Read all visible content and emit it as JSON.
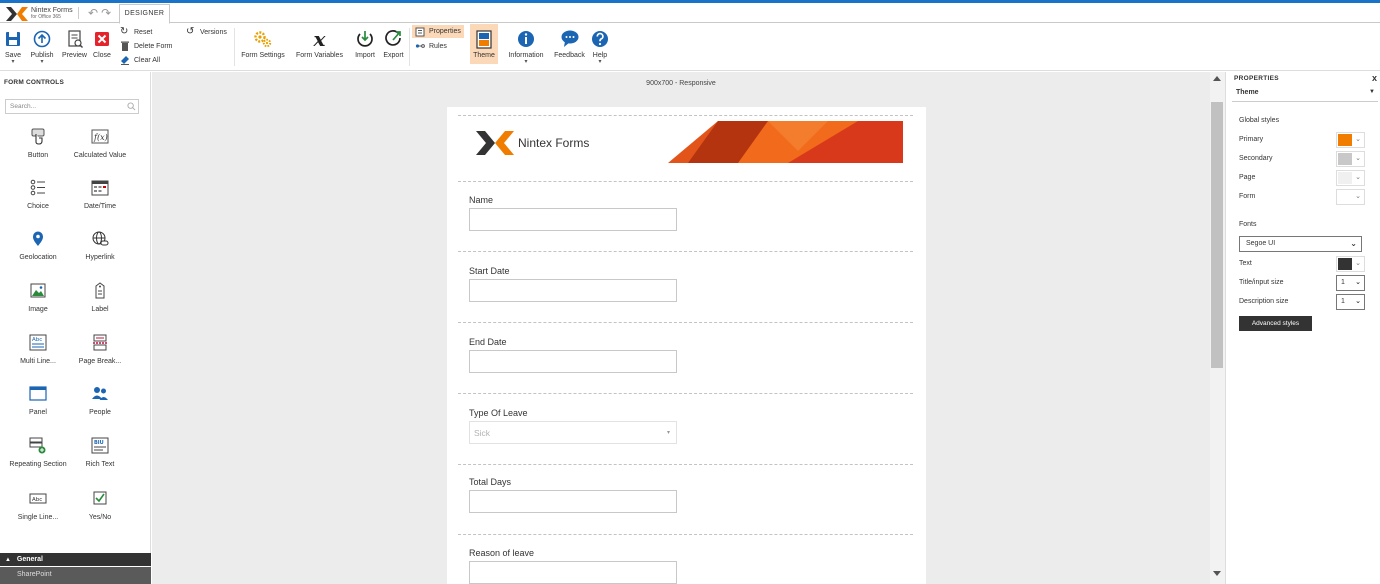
{
  "app": {
    "brand_name": "Nintex Forms",
    "brand_sub": "for Office 365",
    "tab_designer": "DESIGNER",
    "accent_color": "#1a73c6",
    "brand_orange": "#f07d00"
  },
  "ribbon": {
    "save": "Save",
    "publish": "Publish",
    "preview": "Preview",
    "close": "Close",
    "reset": "Reset",
    "delete_form": "Delete Form",
    "clear_all": "Clear All",
    "versions": "Versions",
    "form_settings": "Form Settings",
    "form_variables": "Form Variables",
    "import": "Import",
    "export": "Export",
    "properties": "Properties",
    "rules": "Rules",
    "theme": "Theme",
    "information": "Information",
    "feedback": "Feedback",
    "help": "Help"
  },
  "left_panel": {
    "title": "FORM CONTROLS",
    "search_placeholder": "Search...",
    "controls": [
      {
        "label": "Button"
      },
      {
        "label": "Calculated Value"
      },
      {
        "label": "Choice"
      },
      {
        "label": "Date/Time"
      },
      {
        "label": "Geolocation"
      },
      {
        "label": "Hyperlink"
      },
      {
        "label": "Image"
      },
      {
        "label": "Label"
      },
      {
        "label": "Multi Line..."
      },
      {
        "label": "Page Break..."
      },
      {
        "label": "Panel"
      },
      {
        "label": "People"
      },
      {
        "label": "Repeating Section"
      },
      {
        "label": "Rich Text"
      },
      {
        "label": "Single Line..."
      },
      {
        "label": "Yes/No"
      }
    ],
    "categories": {
      "general": "General",
      "sharepoint": "SharePoint"
    }
  },
  "canvas": {
    "size_label": "900x700 - Responsive",
    "banner_text": "Nintex Forms",
    "fields": [
      {
        "label": "Name",
        "value": ""
      },
      {
        "label": "Start Date",
        "value": ""
      },
      {
        "label": "End Date",
        "value": ""
      },
      {
        "label": "Type Of Leave",
        "value": "Sick"
      },
      {
        "label": "Total Days",
        "value": ""
      },
      {
        "label": "Reason of leave",
        "value": ""
      }
    ]
  },
  "properties": {
    "header": "PROPERTIES",
    "close": "x",
    "selected": "Theme",
    "global_styles": "Global styles",
    "primary": "Primary",
    "secondary": "Secondary",
    "page": "Page",
    "form": "Form",
    "fonts": "Fonts",
    "font_value": "Segoe UI",
    "text": "Text",
    "title_input_size": "Title/input size",
    "title_input_size_value": "1",
    "description_size": "Description size",
    "description_size_value": "1",
    "advanced_styles": "Advanced styles",
    "colors": {
      "primary": "#f07d00",
      "secondary": "#c8c8c8",
      "page": "#f0f0f0",
      "form": "#ffffff",
      "text": "#333333"
    }
  }
}
